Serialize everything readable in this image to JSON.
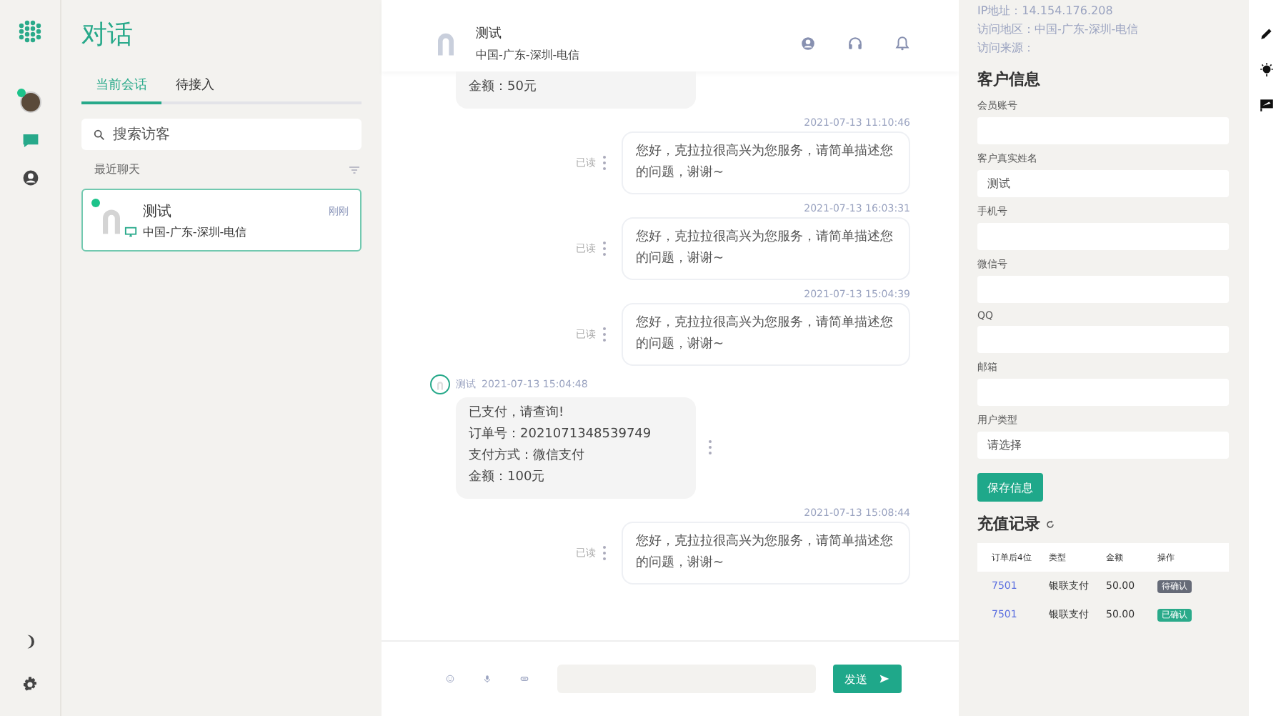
{
  "nav": {
    "profile": {
      "online": true
    },
    "items": [
      {
        "kind": "chat",
        "selected": true
      },
      {
        "kind": "user",
        "selected": false
      }
    ],
    "bottom": [
      {
        "kind": "moon"
      },
      {
        "kind": "gear"
      }
    ]
  },
  "sessions": {
    "title": "对话",
    "tabs": [
      {
        "label": "当前会话",
        "selected": true
      },
      {
        "label": "待接入",
        "selected": false
      }
    ],
    "search": {
      "placeholder": "搜索访客"
    },
    "section": "最近聊天",
    "items": [
      {
        "name": "测试",
        "location": "中国-广东-深圳-电信",
        "time": "刚刚",
        "online": true,
        "selected": true
      }
    ]
  },
  "chat": {
    "header": {
      "name": "测试",
      "location": "中国-广东-深圳-电信"
    },
    "messages": [
      {
        "kind": "customer",
        "lines": [
          "金额：50元"
        ]
      },
      {
        "kind": "agent",
        "time": "2021-07-13 11:10:46",
        "text": "您好，克拉拉很高兴为您服务，请简单描述您的问题，谢谢~",
        "status": "已读"
      },
      {
        "kind": "agent",
        "time": "2021-07-13 16:03:31",
        "text": "您好，克拉拉很高兴为您服务，请简单描述您的问题，谢谢~",
        "status": "已读"
      },
      {
        "kind": "agent",
        "time": "2021-07-13 15:04:39",
        "text": "您好，克拉拉很高兴为您服务，请简单描述您的问题，谢谢~",
        "status": "已读"
      },
      {
        "kind": "customer",
        "name": "测试",
        "time": "2021-07-13 15:04:48",
        "lines": [
          "已支付，请查询!",
          "订单号：2021071348539749",
          "支付方式：微信支付",
          "金额：100元"
        ]
      },
      {
        "kind": "agent",
        "time": "2021-07-13 15:08:44",
        "text": "您好，克拉拉很高兴为您服务，请简单描述您的问题，谢谢~",
        "status": "已读"
      }
    ],
    "send": "发送"
  },
  "visitor": {
    "lines": [
      "IP地址：14.154.176.208",
      "访问地区：中国-广东-深圳-电信",
      "访问来源："
    ]
  },
  "customer": {
    "title": "客户信息",
    "fields": [
      {
        "label": "会员账号"
      },
      {
        "label": "客户真实姓名",
        "value": "测试"
      },
      {
        "label": "手机号"
      },
      {
        "label": "微信号"
      },
      {
        "label": "QQ"
      },
      {
        "label": "邮箱"
      },
      {
        "label": "用户类型",
        "value": "请选择"
      }
    ],
    "save": "保存信息"
  },
  "recharge": {
    "title": "充值记录",
    "columns": [
      "订单后4位",
      "类型",
      "金额",
      "操作"
    ],
    "rows": [
      {
        "order": "7501",
        "type": "银联支付",
        "amount": "50.00",
        "action": "待确认",
        "confirmed": false
      },
      {
        "order": "7501",
        "type": "银联支付",
        "amount": "50.00",
        "action": "已确认",
        "confirmed": true
      }
    ]
  },
  "tools": [
    {
      "kind": "pen"
    },
    {
      "kind": "bulb"
    },
    {
      "kind": "screen"
    }
  ]
}
